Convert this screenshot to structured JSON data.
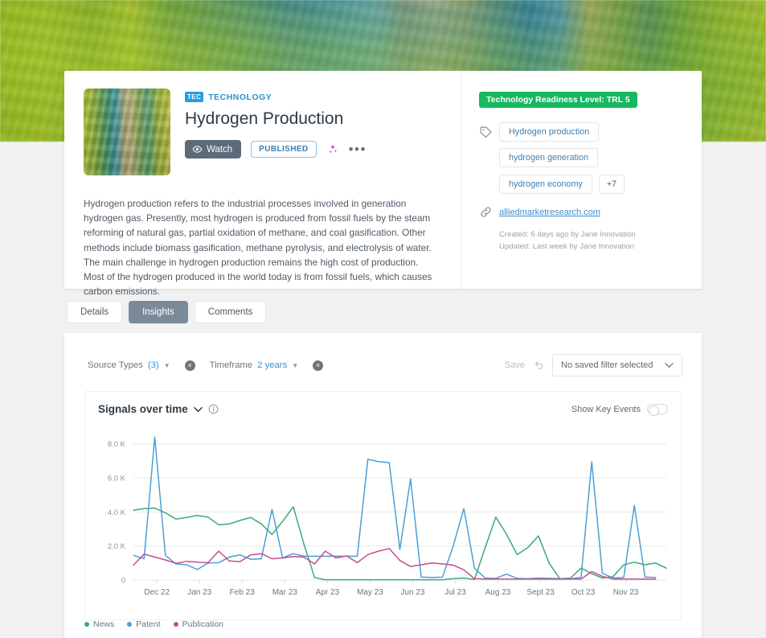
{
  "banner": {
    "alt": "industrial-hydrogen-plant-photo"
  },
  "card": {
    "kicker_badge": "TEC",
    "kicker_text": "TECHNOLOGY",
    "title": "Hydrogen Production",
    "watch_label": "Watch",
    "published_label": "PUBLISHED",
    "more_label": "•••",
    "description": "Hydrogen production refers to the industrial processes involved in generation hydrogen gas. Presently, most hydrogen is produced from fossil fuels by the steam reforming of natural gas, partial oxidation of methane, and coal gasification. Other methods include biomass gasification, methane pyrolysis, and electrolysis of water. The main challenge in hydrogen production remains the high cost of production. Most of the hydrogen produced in the world today is from fossil fuels, which causes carbon emissions."
  },
  "details": {
    "trl_badge": "Technology Readiness Level: TRL 5",
    "tags": [
      "Hydrogen production",
      "hydrogen generation",
      "hydrogen economy"
    ],
    "tags_more": "+7",
    "link": "alliedmarketresearch.com",
    "created": "Created: 6 days ago by Jane Innovation",
    "updated": "Updated: Last week by Jane Innovation"
  },
  "tabs": [
    {
      "label": "Details",
      "active": false
    },
    {
      "label": "Insights",
      "active": true
    },
    {
      "label": "Comments",
      "active": false
    }
  ],
  "filters": {
    "source_types_label": "Source Types",
    "source_types_value": "(3)",
    "timeframe_label": "Timeframe",
    "timeframe_value": "2 years",
    "save_label": "Save",
    "saved_filter_value": "No saved filter selected"
  },
  "chart_card": {
    "title": "Signals over time",
    "key_events_label": "Show Key Events",
    "key_events_on": false
  },
  "colors": {
    "news": "#3aab78",
    "patent": "#4a9fd5",
    "publication": "#c44f8c",
    "trl_green": "#17b85f",
    "accent_blue": "#3b8fd0",
    "tab_active": "#7b8a99"
  },
  "chart_data": {
    "type": "line",
    "title": "Signals over time",
    "xlabel": "",
    "ylabel": "",
    "ylim": [
      0,
      8600
    ],
    "yticks": [
      0,
      2000,
      4000,
      6000,
      8000
    ],
    "ytick_labels": [
      "0",
      "2.0 K",
      "4.0 K",
      "6.0 K",
      "8.0 K"
    ],
    "grid": true,
    "legend_position": "bottom-left",
    "categories": [
      "Dec 22",
      "Jan 23",
      "Feb 23",
      "Mar 23",
      "Apr 23",
      "May 23",
      "Jun 23",
      "Jul 23",
      "Aug 23",
      "Sept 23",
      "Oct 23",
      "Nov 23"
    ],
    "x_points": 49,
    "series": [
      {
        "name": "News",
        "color": "#3aab78",
        "values": [
          4100,
          4200,
          4230,
          3950,
          3580,
          3680,
          3800,
          3700,
          3250,
          3300,
          3500,
          3680,
          3300,
          2680,
          3450,
          4300,
          2100,
          150,
          20,
          20,
          20,
          20,
          20,
          20,
          20,
          20,
          20,
          20,
          20,
          20,
          80,
          120,
          40,
          1900,
          3700,
          2700,
          1500,
          1900,
          2600,
          1000,
          80,
          120,
          700,
          380,
          120,
          200,
          900,
          1050,
          900,
          1000,
          700
        ]
      },
      {
        "name": "Patent",
        "color": "#4a9fd5",
        "values": [
          1450,
          1250,
          8400,
          1450,
          950,
          900,
          620,
          1000,
          1020,
          1350,
          1480,
          1220,
          1250,
          4150,
          1300,
          1550,
          1400,
          1400,
          1400,
          1400,
          1400,
          1400,
          7100,
          6950,
          6900,
          1800,
          5950,
          180,
          150,
          170,
          2000,
          4200,
          700,
          120,
          100,
          350,
          100,
          80,
          120,
          100,
          90,
          80,
          150,
          6950,
          400,
          120,
          150,
          4380,
          180,
          150
        ]
      },
      {
        "name": "Publication",
        "color": "#c44f8c",
        "values": [
          880,
          1520,
          1350,
          1180,
          980,
          1100,
          1050,
          1020,
          1700,
          1120,
          1080,
          1480,
          1550,
          1250,
          1300,
          1380,
          1350,
          950,
          1700,
          1300,
          1420,
          1020,
          1500,
          1700,
          1850,
          1150,
          800,
          900,
          1000,
          950,
          880,
          600,
          80,
          60,
          60,
          60,
          60,
          60,
          60,
          60,
          60,
          60,
          60,
          500,
          220,
          60,
          60,
          60,
          60,
          60
        ]
      }
    ]
  },
  "legend": [
    {
      "label": "News",
      "color": "#3aab78"
    },
    {
      "label": "Patent",
      "color": "#4a9fd5"
    },
    {
      "label": "Publication",
      "color": "#c44f8c"
    }
  ]
}
